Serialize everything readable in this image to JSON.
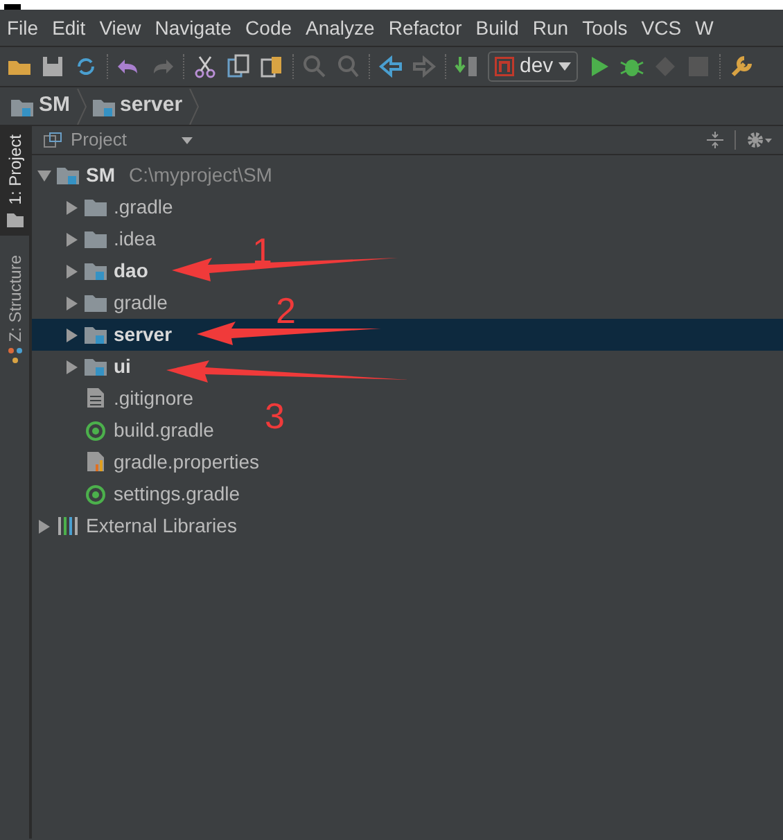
{
  "menu": [
    "File",
    "Edit",
    "View",
    "Navigate",
    "Code",
    "Analyze",
    "Refactor",
    "Build",
    "Run",
    "Tools",
    "VCS",
    "W"
  ],
  "toolbar": {
    "run_config": "dev"
  },
  "breadcrumbs": [
    {
      "label": "SM"
    },
    {
      "label": "server"
    }
  ],
  "tool_tabs": [
    {
      "label": "1: Project",
      "selected": true
    },
    {
      "label": "Z: Structure",
      "selected": false
    }
  ],
  "project_panel": {
    "view": "Project",
    "tree": [
      {
        "label": "SM",
        "kind": "module",
        "path": "C:\\myproject\\SM",
        "expanded": true,
        "selected": false,
        "children": [
          {
            "label": ".gradle",
            "kind": "folder",
            "expanded": false,
            "selected": false
          },
          {
            "label": ".idea",
            "kind": "folder",
            "expanded": false,
            "selected": false
          },
          {
            "label": "dao",
            "kind": "module",
            "expanded": false,
            "selected": false
          },
          {
            "label": "gradle",
            "kind": "folder",
            "expanded": false,
            "selected": false
          },
          {
            "label": "server",
            "kind": "module",
            "expanded": false,
            "selected": true
          },
          {
            "label": "ui",
            "kind": "module",
            "expanded": false,
            "selected": false
          },
          {
            "label": ".gitignore",
            "kind": "text",
            "selected": false
          },
          {
            "label": "build.gradle",
            "kind": "gradle",
            "selected": false
          },
          {
            "label": "gradle.properties",
            "kind": "properties",
            "selected": false
          },
          {
            "label": "settings.gradle",
            "kind": "gradle",
            "selected": false
          }
        ]
      },
      {
        "label": "External Libraries",
        "kind": "libraries",
        "expanded": false,
        "selected": false
      }
    ]
  },
  "annotations": [
    {
      "label": "1"
    },
    {
      "label": "2"
    },
    {
      "label": "3"
    }
  ]
}
